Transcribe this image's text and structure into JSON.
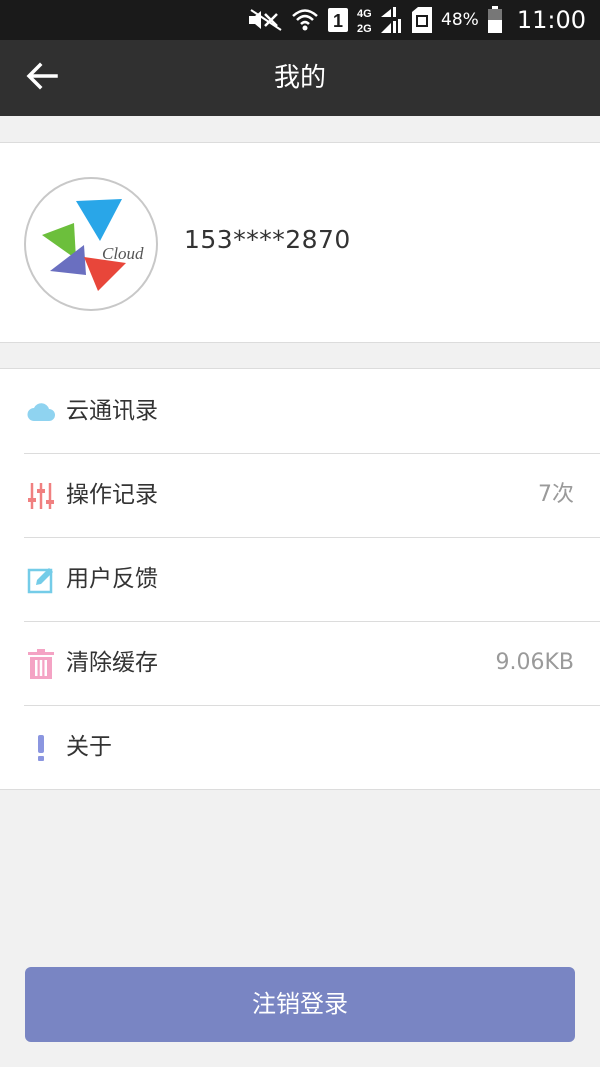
{
  "status_bar": {
    "battery_pct": "48%",
    "time": "11:00",
    "sim_slot": "1",
    "network_top": "4G",
    "network_bottom": "2G"
  },
  "app_bar": {
    "title": "我的",
    "back_icon": "back-arrow-icon"
  },
  "profile": {
    "avatar_text": "Cloud",
    "phone": "153****2870"
  },
  "menu": [
    {
      "label": "云通讯录",
      "value": "",
      "icon": "cloud-icon",
      "color": "#8fd3f0"
    },
    {
      "label": "操作记录",
      "value": "7次",
      "icon": "equalizer-icon",
      "color": "#f08080"
    },
    {
      "label": "用户反馈",
      "value": "",
      "icon": "edit-icon",
      "color": "#74cce8"
    },
    {
      "label": "清除缓存",
      "value": "9.06KB",
      "icon": "trash-icon",
      "color": "#f4a3c4"
    },
    {
      "label": "关于",
      "value": "",
      "icon": "exclamation-icon",
      "color": "#8b96e0"
    }
  ],
  "logout_button": {
    "label": "注销登录",
    "color": "#7985c3"
  }
}
